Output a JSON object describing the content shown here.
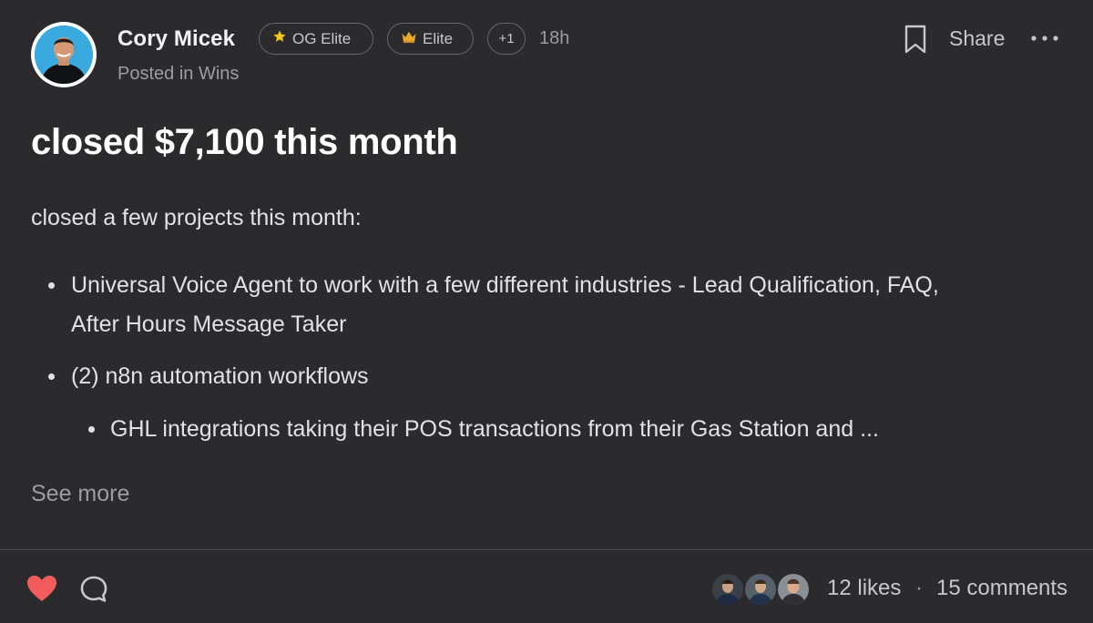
{
  "post": {
    "author": "Cory Micek",
    "posted_in": "Posted in Wins",
    "badges": [
      {
        "icon": "star-icon",
        "label": "OG Elite"
      },
      {
        "icon": "crown-icon",
        "label": "Elite"
      },
      {
        "label": "+1"
      }
    ],
    "time": "18h",
    "share_label": "Share",
    "title": "closed $7,100 this month",
    "intro": "closed a few projects this month:",
    "bullets": [
      "Universal Voice Agent to work with a few different industries - Lead Qualification, FAQ, After Hours Message Taker",
      "(2) n8n automation workflows"
    ],
    "sub_bullets": [
      "GHL integrations taking their POS transactions from their Gas Station and ..."
    ],
    "see_more": "See more"
  },
  "footer": {
    "likes": "12 likes",
    "separator": "·",
    "comments": "15 comments",
    "reactions": [
      "heart-icon",
      "comment-icon"
    ]
  },
  "colors": {
    "background": "#2b2b2e",
    "heart": "#f25c5c",
    "badge_border": "#66666b",
    "muted_text": "#9c9ca2"
  }
}
